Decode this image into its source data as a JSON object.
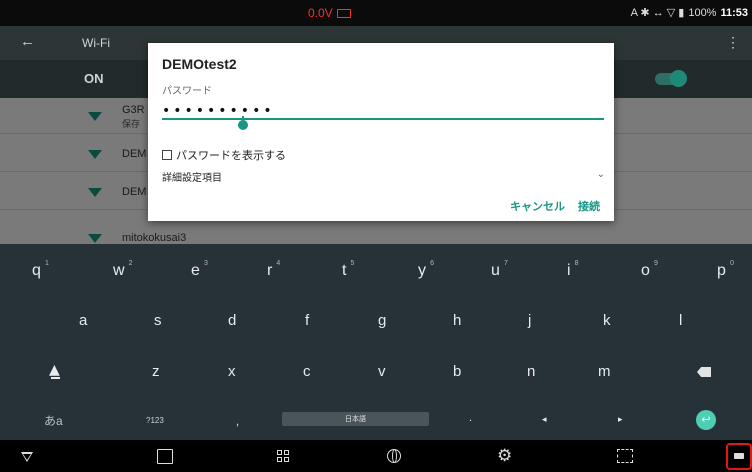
{
  "status": {
    "voltage": "0.0V",
    "indicators": "A ✱ ↔ ▽ ▮",
    "battery_percent": "100%",
    "time": "11:53"
  },
  "appbar": {
    "title": "Wi-Fi"
  },
  "wifi_toggle": {
    "label": "ON",
    "on": true
  },
  "networks": [
    {
      "name": "G3R",
      "subtitle": "保存"
    },
    {
      "name": "DEM"
    },
    {
      "name": "DEM"
    },
    {
      "name": "mitokokusai3"
    }
  ],
  "dialog": {
    "title": "DEMOtest2",
    "password_label": "パスワード",
    "password_value": "••••••••••",
    "show_password_label": "パスワードを表示する",
    "advanced_label": "詳細設定項目",
    "cancel_label": "キャンセル",
    "connect_label": "接続"
  },
  "keyboard": {
    "row1": [
      {
        "k": "q",
        "h": "1"
      },
      {
        "k": "w",
        "h": "2"
      },
      {
        "k": "e",
        "h": "3"
      },
      {
        "k": "r",
        "h": "4"
      },
      {
        "k": "t",
        "h": "5"
      },
      {
        "k": "y",
        "h": "6"
      },
      {
        "k": "u",
        "h": "7"
      },
      {
        "k": "i",
        "h": "8"
      },
      {
        "k": "o",
        "h": "9"
      },
      {
        "k": "p",
        "h": "0"
      }
    ],
    "row2": [
      "a",
      "s",
      "d",
      "f",
      "g",
      "h",
      "j",
      "k",
      "l"
    ],
    "row3": [
      "z",
      "x",
      "c",
      "v",
      "b",
      "n",
      "m"
    ],
    "lang_key": "あa",
    "num_key": "?123",
    "comma": ",",
    "space_label": "日本語",
    "period": ".",
    "left_arrow": "◂",
    "right_arrow": "▸",
    "enter_symbol": "↩"
  },
  "navbar": {
    "gear": "⚙"
  }
}
